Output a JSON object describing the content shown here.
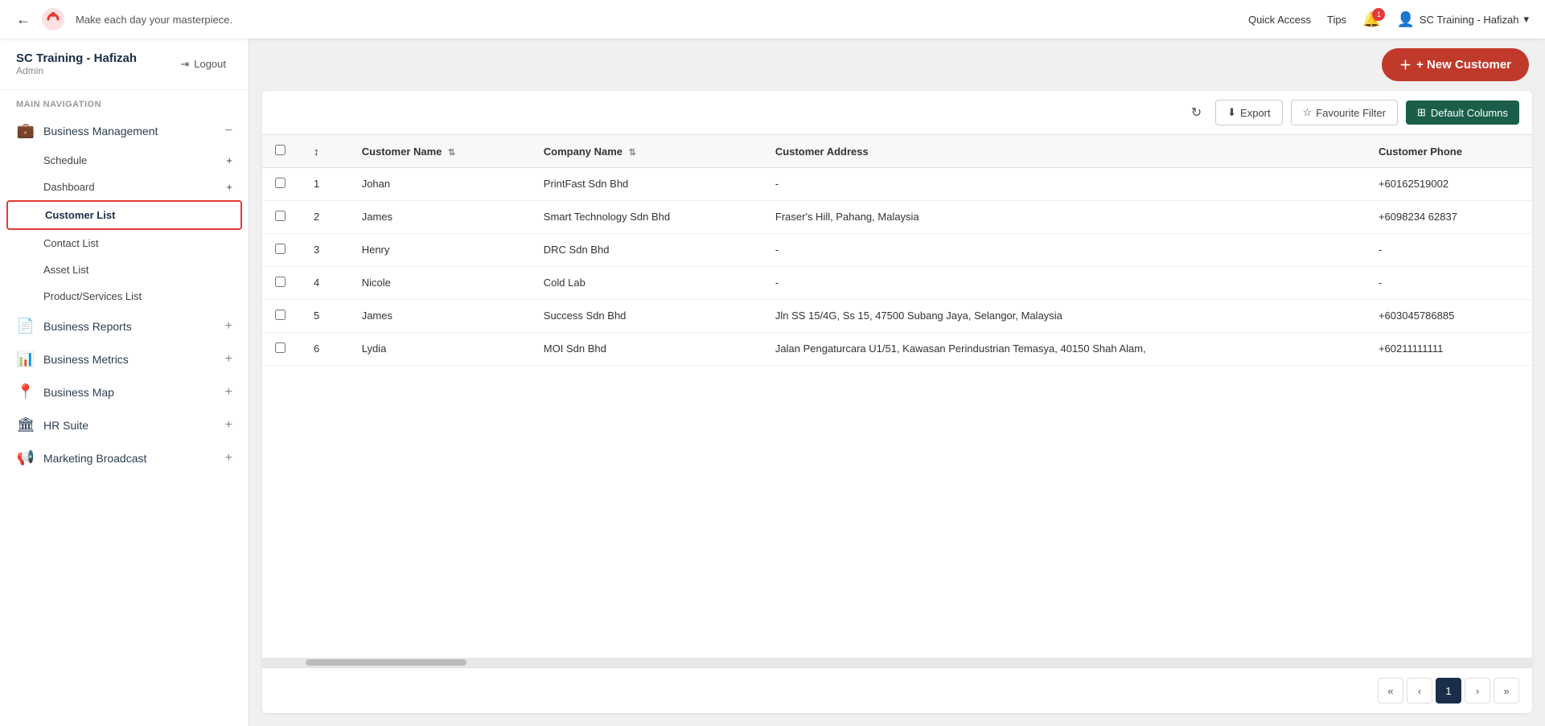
{
  "navbar": {
    "back_icon": "←",
    "tagline": "Make each day your masterpiece.",
    "quick_access": "Quick Access",
    "tips": "Tips",
    "bell_count": "1",
    "user": "SC Training - Hafizah",
    "user_chevron": "▾"
  },
  "sidebar": {
    "username": "SC Training - Hafizah",
    "role": "Admin",
    "logout_label": "Logout",
    "nav_section": "MAIN NAVIGATION",
    "items": [
      {
        "id": "business-management",
        "label": "Business Management",
        "icon": "💼",
        "toggle": "−",
        "expanded": true,
        "children": [
          {
            "id": "schedule",
            "label": "Schedule",
            "toggle": "+"
          },
          {
            "id": "dashboard",
            "label": "Dashboard",
            "toggle": "+"
          },
          {
            "id": "customer-list",
            "label": "Customer List",
            "toggle": "",
            "active": true
          },
          {
            "id": "contact-list",
            "label": "Contact List",
            "toggle": ""
          },
          {
            "id": "asset-list",
            "label": "Asset List",
            "toggle": ""
          },
          {
            "id": "product-services-list",
            "label": "Product/Services List",
            "toggle": ""
          }
        ]
      },
      {
        "id": "business-reports",
        "label": "Business Reports",
        "icon": "📄",
        "toggle": "+"
      },
      {
        "id": "business-metrics",
        "label": "Business Metrics",
        "icon": "📊",
        "toggle": "+"
      },
      {
        "id": "business-map",
        "label": "Business Map",
        "icon": "📍",
        "toggle": "+"
      },
      {
        "id": "hr-suite",
        "label": "HR Suite",
        "icon": "🏛",
        "toggle": "+"
      },
      {
        "id": "marketing-broadcast",
        "label": "Marketing Broadcast",
        "icon": "📢",
        "toggle": "+"
      }
    ]
  },
  "main": {
    "new_customer_label": "+ New Customer",
    "toolbar": {
      "refresh_icon": "↻",
      "export_label": "Export",
      "export_icon": "⬇",
      "favourite_filter_label": "Favourite Filter",
      "favourite_icon": "☆",
      "default_columns_label": "Default Columns",
      "default_columns_icon": "⊞"
    },
    "table": {
      "columns": [
        {
          "id": "checkbox",
          "label": ""
        },
        {
          "id": "customer-name",
          "label": "Customer Name",
          "sortable": true
        },
        {
          "id": "company-name",
          "label": "Company Name",
          "sortable": true
        },
        {
          "id": "customer-address",
          "label": "Customer Address",
          "sortable": false
        },
        {
          "id": "customer-phone",
          "label": "Customer Phone",
          "sortable": false
        }
      ],
      "rows": [
        {
          "customer_name": "Johan",
          "company_name": "PrintFast Sdn Bhd",
          "address": "-",
          "phone": "+60162519002"
        },
        {
          "customer_name": "James",
          "company_name": "Smart Technology Sdn Bhd",
          "address": "Fraser's Hill, Pahang, Malaysia",
          "phone": "+6098234 62837"
        },
        {
          "customer_name": "Henry",
          "company_name": "DRC Sdn Bhd",
          "address": "-",
          "phone": "-"
        },
        {
          "customer_name": "Nicole",
          "company_name": "Cold Lab",
          "address": "-",
          "phone": "-"
        },
        {
          "customer_name": "James",
          "company_name": "Success Sdn Bhd",
          "address": "Jln SS 15/4G, Ss 15, 47500 Subang Jaya, Selangor, Malaysia",
          "phone": "+603045786885"
        },
        {
          "customer_name": "Lydia",
          "company_name": "MOI Sdn Bhd",
          "address": "Jalan Pengaturcara U1/51, Kawasan Perindustrian Temasya, 40150 Shah Alam,",
          "phone": "+60211111111"
        }
      ]
    },
    "pagination": {
      "first": "«",
      "prev": "‹",
      "current": "1",
      "next": "›",
      "last": "»"
    }
  }
}
